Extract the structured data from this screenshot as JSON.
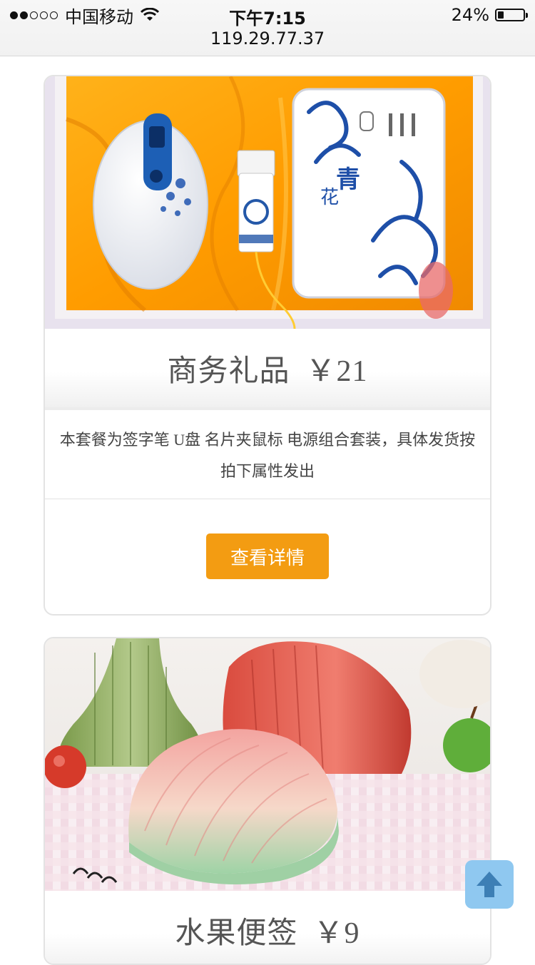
{
  "status_bar": {
    "carrier": "中国移动",
    "time": "下午7:15",
    "battery": "24%",
    "battery_level": 0.24,
    "signal_filled": 2,
    "signal_total": 5
  },
  "browser": {
    "url": "119.29.77.37"
  },
  "products": [
    {
      "name": "商务礼品",
      "price": "￥21",
      "description": "本套餐为签字笔 U盘 名片夹鼠标 电源组合套装，具体发货按拍下属性发出",
      "button": "查看详情",
      "image": "blue-and-white porcelain gift set"
    },
    {
      "name": "水果便签",
      "price": "￥9",
      "image": "fruit-shaped sticky notes"
    }
  ],
  "back_to_top_icon": "arrow-up-icon",
  "colors": {
    "accent": "#f39c12",
    "back_to_top": "#8fc8f0"
  }
}
